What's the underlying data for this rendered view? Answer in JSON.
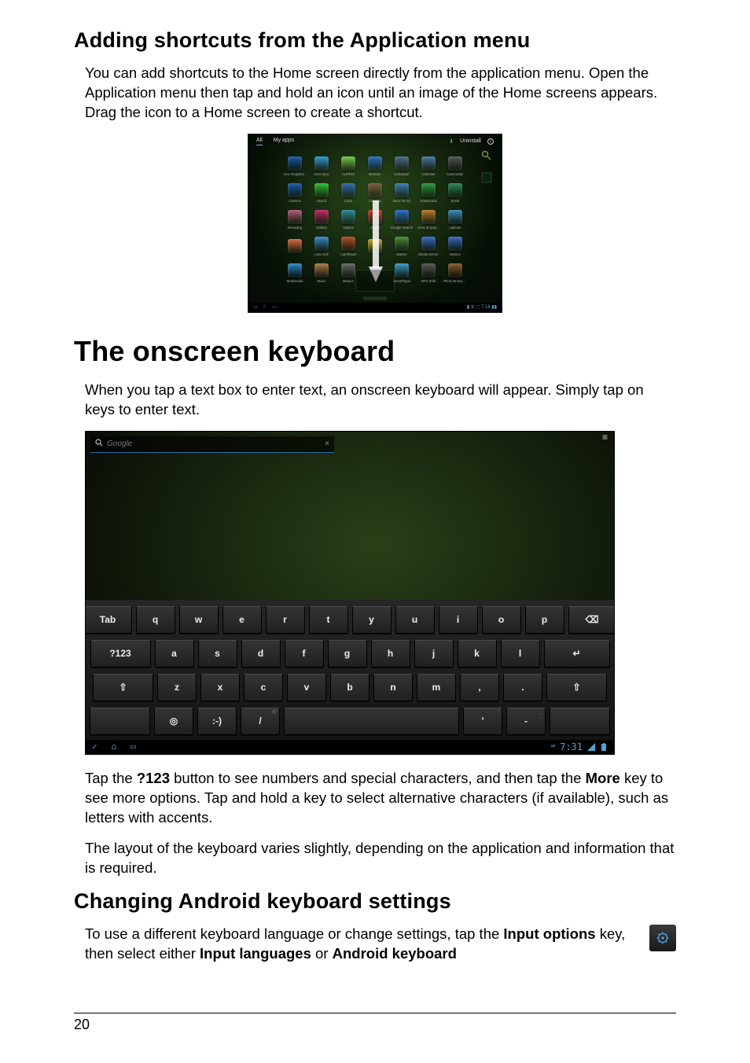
{
  "h2_1": "Adding shortcuts from the Application menu",
  "p1": "You can add shortcuts to the Home screen directly from the application menu. Open the Application menu then tap and hold an icon until an image of the Home screens appears. Drag the icon to a Home screen to create a shortcut.",
  "app_menu": {
    "tabs": {
      "all": "All",
      "myapps": "My apps"
    },
    "uninstall": "Uninstall",
    "icons": [
      {
        "label": "Acer Registra...",
        "color": "#1b5aa8"
      },
      {
        "label": "Acer Sync",
        "color": "#2e9bd6"
      },
      {
        "label": "AUPEO!",
        "color": "#7cc84d"
      },
      {
        "label": "Browser",
        "color": "#2a6fc2"
      },
      {
        "label": "Calculator",
        "color": "#4a6a88"
      },
      {
        "label": "Calendar",
        "color": "#4a789e"
      },
      {
        "label": "Camcorder",
        "color": "#555"
      },
      {
        "label": "Camera",
        "color": "#1b5aa8"
      },
      {
        "label": "clear.fi",
        "color": "#2fbf2f"
      },
      {
        "label": "Clock",
        "color": "#2e6aa8"
      },
      {
        "label": "Contacts",
        "color": "#7a5a3a"
      },
      {
        "label": "Docs To Go",
        "color": "#3a7ab8"
      },
      {
        "label": "Downloads",
        "color": "#2a9a3a"
      },
      {
        "label": "Email",
        "color": "#2a8a5a"
      },
      {
        "label": "eReading",
        "color": "#b05a7a"
      },
      {
        "label": "Gallery",
        "color": "#c2286a"
      },
      {
        "label": "Games",
        "color": "#2a8a9a"
      },
      {
        "label": "Gmail",
        "color": "#c93a2a"
      },
      {
        "label": "Google Search",
        "color": "#2a6acc"
      },
      {
        "label": "Hero of Spar...",
        "color": "#b87a2a"
      },
      {
        "label": "Latitude",
        "color": "#3a8ab8"
      },
      {
        "label": "",
        "color": "#d86a3a"
      },
      {
        "label": "Lets Golf",
        "color": "#3a8acc"
      },
      {
        "label": "LumiRead",
        "color": "#b84a2a"
      },
      {
        "label": "",
        "color": "#c8a82a"
      },
      {
        "label": "Market",
        "color": "#4a8a3a"
      },
      {
        "label": "Media Server",
        "color": "#3a6ac8"
      },
      {
        "label": "MusicA",
        "color": "#3a6ac8"
      },
      {
        "label": "Multimedia",
        "color": "#2a8acc"
      },
      {
        "label": "Music",
        "color": "#b07a4a"
      },
      {
        "label": "MusicA",
        "color": "#666"
      },
      {
        "label": "",
        "color": "transparent"
      },
      {
        "label": "nemoPlayer",
        "color": "#3a9acc"
      },
      {
        "label": "NFS Shift",
        "color": "#555"
      },
      {
        "label": "Photo Browse...",
        "color": "#8a5a2a"
      }
    ],
    "statusbar_time": "7:16"
  },
  "h1": "The onscreen keyboard",
  "p2": "When you tap a text box to enter text, an onscreen keyboard will appear. Simply tap on keys to enter text.",
  "keyboard": {
    "search_placeholder": "Google",
    "row1": [
      "Tab",
      "q",
      "w",
      "e",
      "r",
      "t",
      "y",
      "u",
      "i",
      "o",
      "p",
      "⌫"
    ],
    "row2": [
      "?123",
      "a",
      "s",
      "d",
      "f",
      "g",
      "h",
      "j",
      "k",
      "l",
      "↵"
    ],
    "row3_shift": "⇧",
    "row3": [
      "z",
      "x",
      "c",
      "v",
      "b",
      "n",
      "m",
      ",",
      "."
    ],
    "row4": [
      "◎",
      ":-)",
      "/",
      "space",
      "'",
      "-"
    ],
    "status_time": "7:31"
  },
  "p3a": "Tap the ",
  "p3b": "?123",
  "p3c": " button to see numbers and special characters, and then tap the ",
  "p3d": "More",
  "p3e": " key to see more options. Tap and hold a key to select alternative characters (if available), such as letters with accents.",
  "p4": "The layout of the keyboard varies slightly, depending on the application and information that is required.",
  "h2_2": "Changing Android keyboard settings",
  "p5a": "To use a different keyboard language or change settings, tap the ",
  "p5b": "Input options",
  "p5c": " key, then select either ",
  "p5d": "Input languages",
  "p5e": " or ",
  "p5f": "Android keyboard",
  "page_number": "20"
}
